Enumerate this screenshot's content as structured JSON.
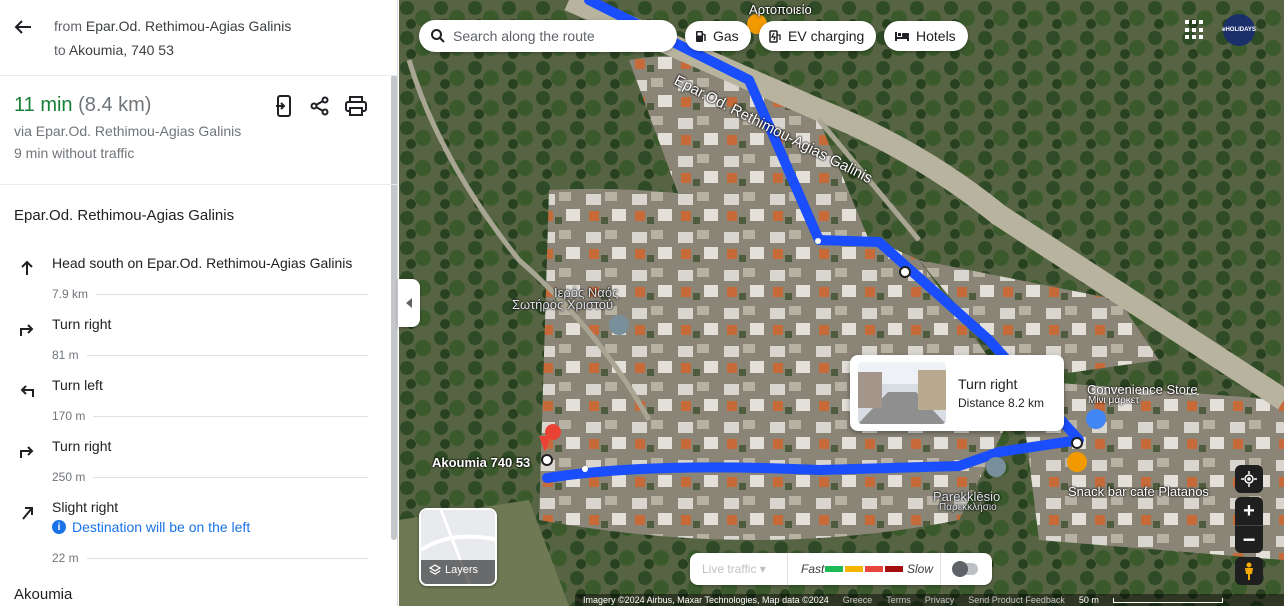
{
  "header": {
    "from_prefix": "from",
    "from_place": "Epar.Od. Rethimou-Agias Galinis",
    "to_prefix": "to",
    "to_place": "Akoumia, 740 53"
  },
  "summary": {
    "duration": "11 min",
    "distance": "(8.4 km)",
    "via": "via Epar.Od. Rethimou-Agias Galinis",
    "no_traffic": "9 min without traffic"
  },
  "road_title": "Epar.Od. Rethimou-Agias Galinis",
  "steps": [
    {
      "icon": "arrow-up-icon",
      "text": "Head south on Epar.Od. Rethimou-Agias Galinis",
      "distance": "7.9 km"
    },
    {
      "icon": "turn-right-icon",
      "text": "Turn right",
      "distance": "81 m"
    },
    {
      "icon": "turn-left-icon",
      "text": "Turn left",
      "distance": "170 m"
    },
    {
      "icon": "turn-right-icon",
      "text": "Turn right",
      "distance": "250 m"
    },
    {
      "icon": "slight-right-icon",
      "text": "Slight right",
      "note": "Destination will be on the left",
      "distance": "22 m"
    }
  ],
  "destination_title": "Akoumia",
  "map": {
    "search_placeholder": "Search along the route",
    "chips": [
      {
        "icon": "gas-icon",
        "label": "Gas"
      },
      {
        "icon": "ev-charging-icon",
        "label": "EV charging"
      },
      {
        "icon": "hotel-icon",
        "label": "Hotels"
      }
    ],
    "avatar_text": "eHOLIDAYS",
    "labels": {
      "road": "Epar.Od. Rethimou-Agias Galinis",
      "bakery": "Αρτοποιείο",
      "church_1": "Ιερός Ναός",
      "church_2": "Σωτήρος Χριστού",
      "convenience": "Convenience Store",
      "convenience_gr": "Μίνι μάρκετ",
      "parekklesio": "Parekklēsio",
      "parekklesio_gr": "Παρεκκλήσιο",
      "snackbar": "Snack bar cafe Platanos",
      "destination": "Akoumia 740 53"
    },
    "popup": {
      "title": "Turn right",
      "subtitle": "Distance 8.2 km"
    },
    "layers_label": "Layers",
    "traffic": {
      "live": "Live traffic",
      "fast": "Fast",
      "slow": "Slow",
      "colors": [
        "#1db954",
        "#f4b400",
        "#e8453c",
        "#a50e0e"
      ]
    },
    "footer": {
      "imagery": "Imagery ©2024 Airbus, Maxar Technologies, Map data ©2024",
      "country": "Greece",
      "terms": "Terms",
      "privacy": "Privacy",
      "feedback": "Send Product Feedback",
      "scale": "50 m"
    },
    "route_color": "#1a4dfc"
  }
}
